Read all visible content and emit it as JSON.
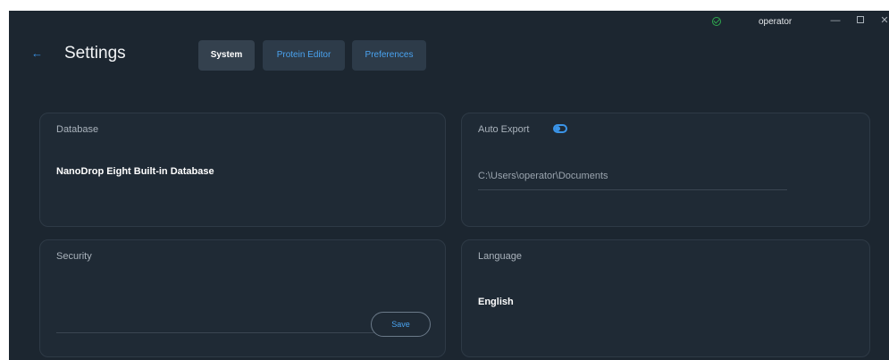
{
  "titlebar": {
    "user": "operator",
    "status_icon": "check-circle-icon",
    "status_color": "#2fa84f",
    "minimize_glyph": "—",
    "close_glyph": "✕"
  },
  "header": {
    "title": "Settings",
    "back_glyph": "←",
    "tabs": [
      {
        "label": "System",
        "active": true
      },
      {
        "label": "Protein Editor",
        "active": false
      },
      {
        "label": "Preferences",
        "active": false
      }
    ]
  },
  "database": {
    "title": "Database",
    "value": "NanoDrop Eight Built-in Database"
  },
  "auto_export": {
    "title": "Auto Export",
    "enabled": true,
    "path": "C:\\Users\\operator\\Documents"
  },
  "security": {
    "title": "Security",
    "save_label": "Save"
  },
  "language": {
    "title": "Language",
    "value": "English"
  },
  "colors": {
    "background": "#1c2630",
    "accent": "#3a94e8",
    "tab_active": "#34414e"
  }
}
